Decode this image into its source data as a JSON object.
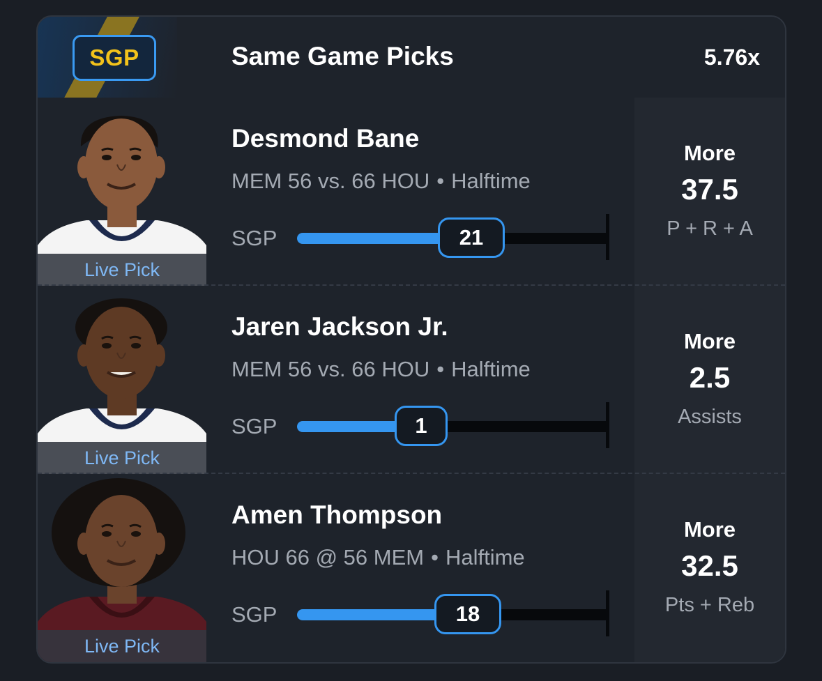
{
  "header": {
    "badge": "SGP",
    "title": "Same Game Picks",
    "multiplier": "5.76x"
  },
  "picks": [
    {
      "player": "Desmond Bane",
      "game": "MEM 56 vs. 66 HOU",
      "status": "Halftime",
      "live_label": "Live Pick",
      "progress_label": "SGP",
      "current": "21",
      "progress": 0.56,
      "direction": "More",
      "line": "37.5",
      "stat": "P + R + A",
      "jersey_color": "#f4f4f4",
      "trim_color": "#1d2a4d"
    },
    {
      "player": "Jaren Jackson Jr.",
      "game": "MEM 56 vs. 66 HOU",
      "status": "Halftime",
      "live_label": "Live Pick",
      "progress_label": "SGP",
      "current": "1",
      "progress": 0.4,
      "direction": "More",
      "line": "2.5",
      "stat": "Assists",
      "jersey_color": "#f4f4f4",
      "trim_color": "#1d2a4d"
    },
    {
      "player": "Amen Thompson",
      "game": "HOU 66 @ 56 MEM",
      "status": "Halftime",
      "live_label": "Live Pick",
      "progress_label": "SGP",
      "current": "18",
      "progress": 0.55,
      "direction": "More",
      "line": "32.5",
      "stat": "Pts + Reb",
      "jersey_color": "#5a1a22",
      "trim_color": "#3a0f14"
    }
  ],
  "colors": {
    "accent_blue": "#3596f0",
    "badge_gold": "#f2c21b",
    "live_pick_text": "#7fb8f5"
  }
}
